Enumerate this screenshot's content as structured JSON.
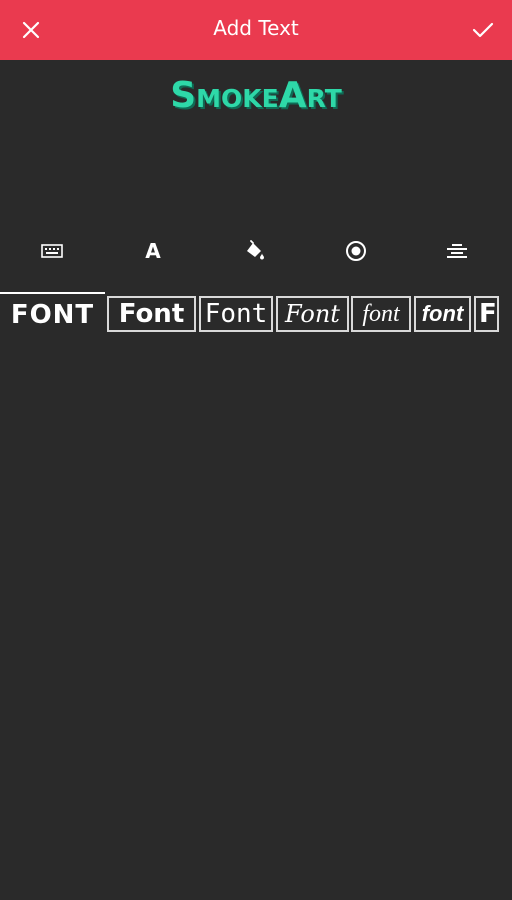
{
  "header": {
    "title": "Add Text",
    "close_icon": "close-icon",
    "done_icon": "checkmark-icon",
    "background_color": "#ea3a4f"
  },
  "preview": {
    "text": "SmokeArt",
    "color": "#2ed8a8"
  },
  "toolbar": {
    "items": [
      {
        "name": "keyboard-icon"
      },
      {
        "name": "font-style-icon",
        "glyph": "A"
      },
      {
        "name": "paint-bucket-icon"
      },
      {
        "name": "stroke-radio-icon"
      },
      {
        "name": "align-center-icon"
      }
    ]
  },
  "font_picker": {
    "items": [
      {
        "label": "FONT",
        "selected": true
      },
      {
        "label": "Font"
      },
      {
        "label": "Font"
      },
      {
        "label": "Font"
      },
      {
        "label": "font"
      },
      {
        "label": "font"
      },
      {
        "label": "F"
      }
    ]
  }
}
